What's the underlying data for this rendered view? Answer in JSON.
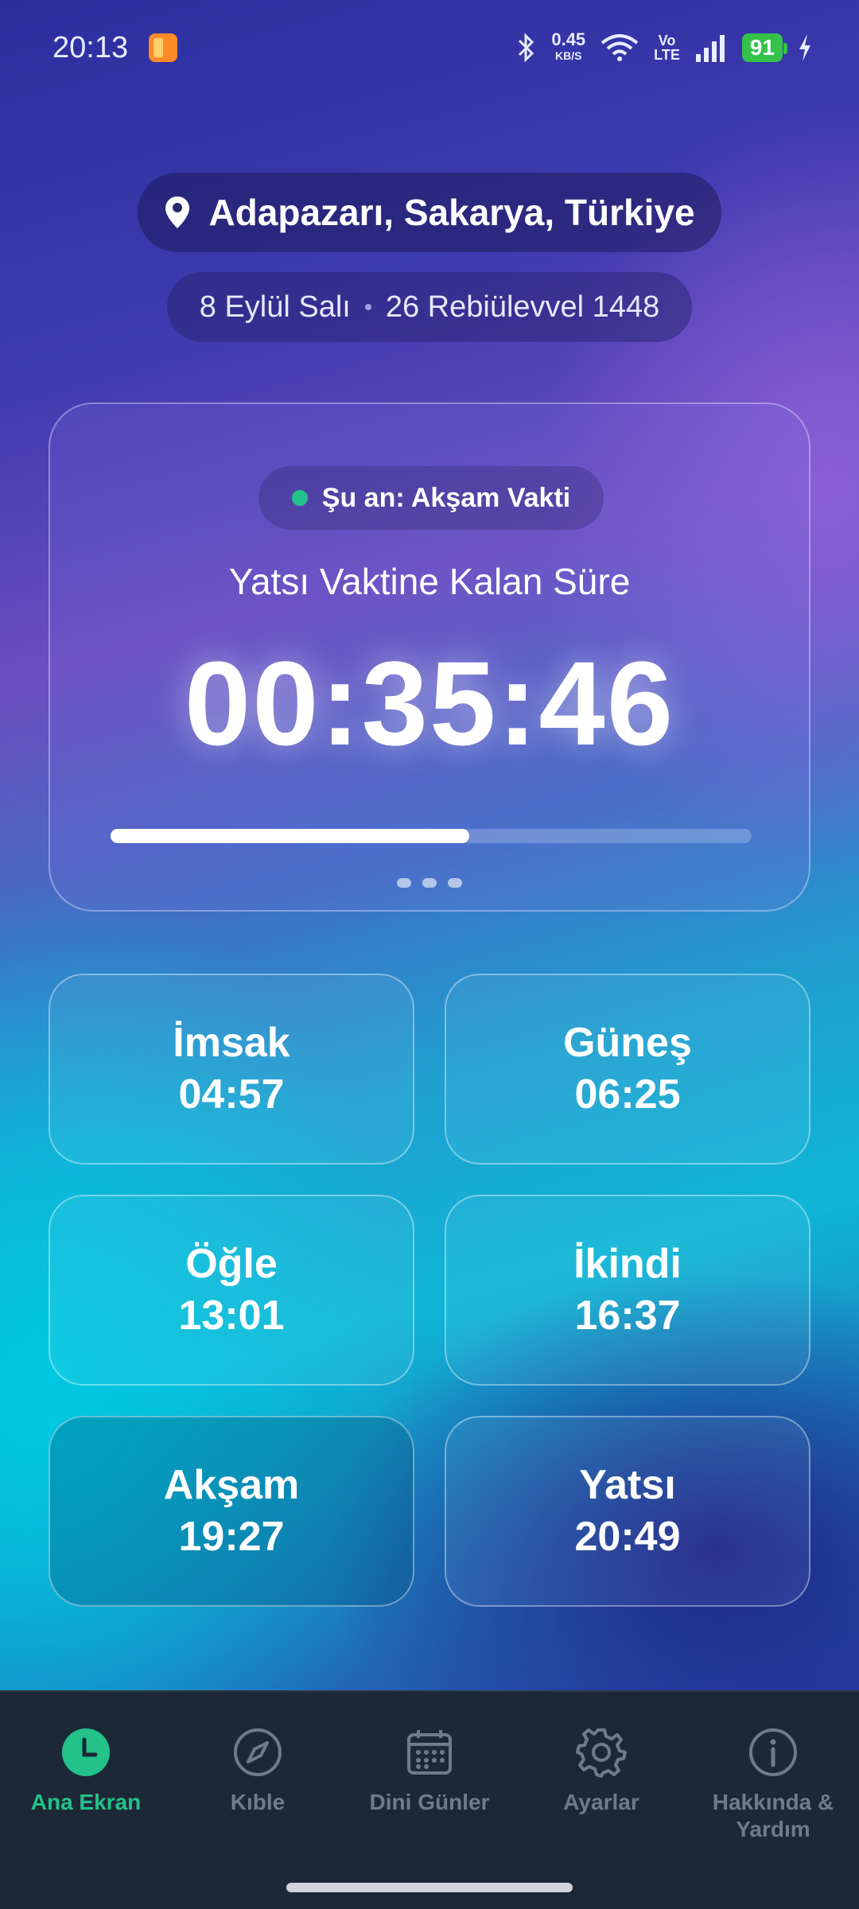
{
  "status_bar": {
    "time": "20:13",
    "net_speed_value": "0.45",
    "net_speed_unit": "KB/S",
    "volte_top": "Vo",
    "volte_bottom": "LTE",
    "battery": "91"
  },
  "header": {
    "location": "Adapazarı, Sakarya, Türkiye",
    "gregorian_date": "8 Eylül Salı",
    "hijri_date": "26 Rebiülevvel 1448"
  },
  "countdown_card": {
    "current_status": "Şu an: Akşam Vakti",
    "remaining_label": "Yatsı Vaktine Kalan Süre",
    "countdown": "00:35:46",
    "progress_fraction": 0.56,
    "pager_count": 3
  },
  "prayer_times": [
    {
      "name": "İmsak",
      "time": "04:57"
    },
    {
      "name": "Güneş",
      "time": "06:25"
    },
    {
      "name": "Öğle",
      "time": "13:01"
    },
    {
      "name": "İkindi",
      "time": "16:37"
    },
    {
      "name": "Akşam",
      "time": "19:27",
      "active": true
    },
    {
      "name": "Yatsı",
      "time": "20:49"
    }
  ],
  "bottom_nav": {
    "items": [
      {
        "label": "Ana Ekran",
        "icon": "clock-icon",
        "active": true
      },
      {
        "label": "Kıble",
        "icon": "compass-icon"
      },
      {
        "label": "Dini Günler",
        "icon": "calendar-icon"
      },
      {
        "label": "Ayarlar",
        "icon": "gear-icon"
      },
      {
        "label": "Hakkında & Yardım",
        "icon": "info-icon"
      }
    ]
  },
  "colors": {
    "accent": "#23c28a",
    "nav_bg": "#1d2836",
    "battery": "#34c24a"
  }
}
